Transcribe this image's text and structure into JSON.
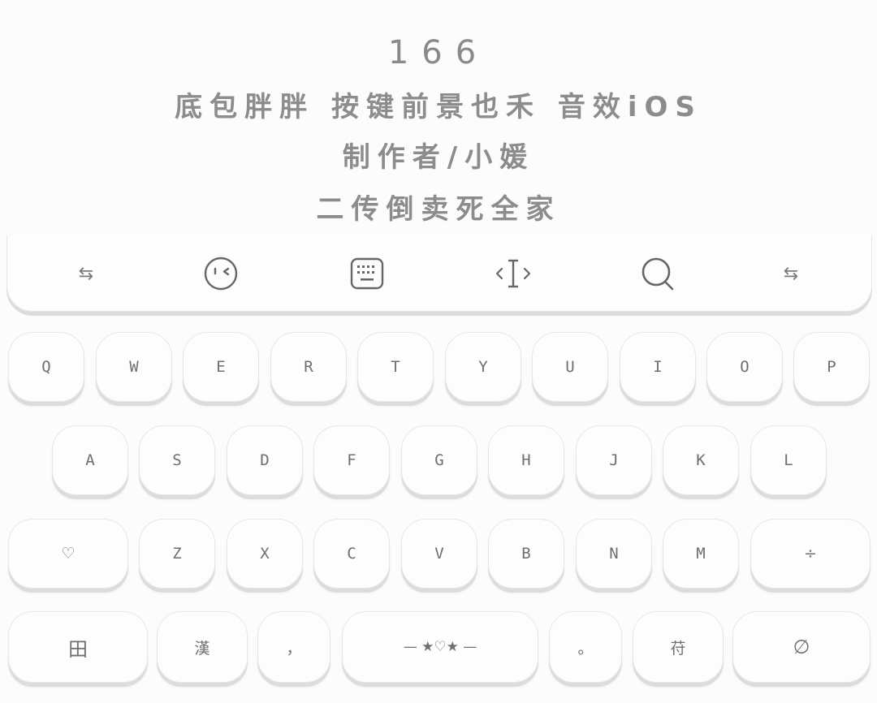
{
  "header": {
    "line1": "166",
    "line2": "底包胖胖 按键前景也禾 音效iOS",
    "line3": "制作者/小媛",
    "line4": "二传倒卖死全家"
  },
  "toolbar": {
    "left_swap": "⇆",
    "right_swap": "⇆"
  },
  "keys": {
    "row1": [
      "Q",
      "W",
      "E",
      "R",
      "T",
      "Y",
      "U",
      "I",
      "O",
      "P"
    ],
    "row2": [
      "A",
      "S",
      "D",
      "F",
      "G",
      "H",
      "J",
      "K",
      "L"
    ],
    "row3": {
      "shift": "♡",
      "letters": [
        "Z",
        "X",
        "C",
        "V",
        "B",
        "N",
        "M"
      ],
      "delete": "÷"
    },
    "row4": {
      "numbers": "田",
      "chinese": "漢",
      "comma": "，",
      "space": "— ★♡★ —",
      "period": "。",
      "symbols": "苻",
      "enter": "∅"
    }
  },
  "colors": {
    "background": "#fcfcfc",
    "key_face": "#fdfdfd",
    "key_shadow": "#dcdcdc",
    "text": "#6f6f6f",
    "header_text": "#8c8c8c"
  }
}
